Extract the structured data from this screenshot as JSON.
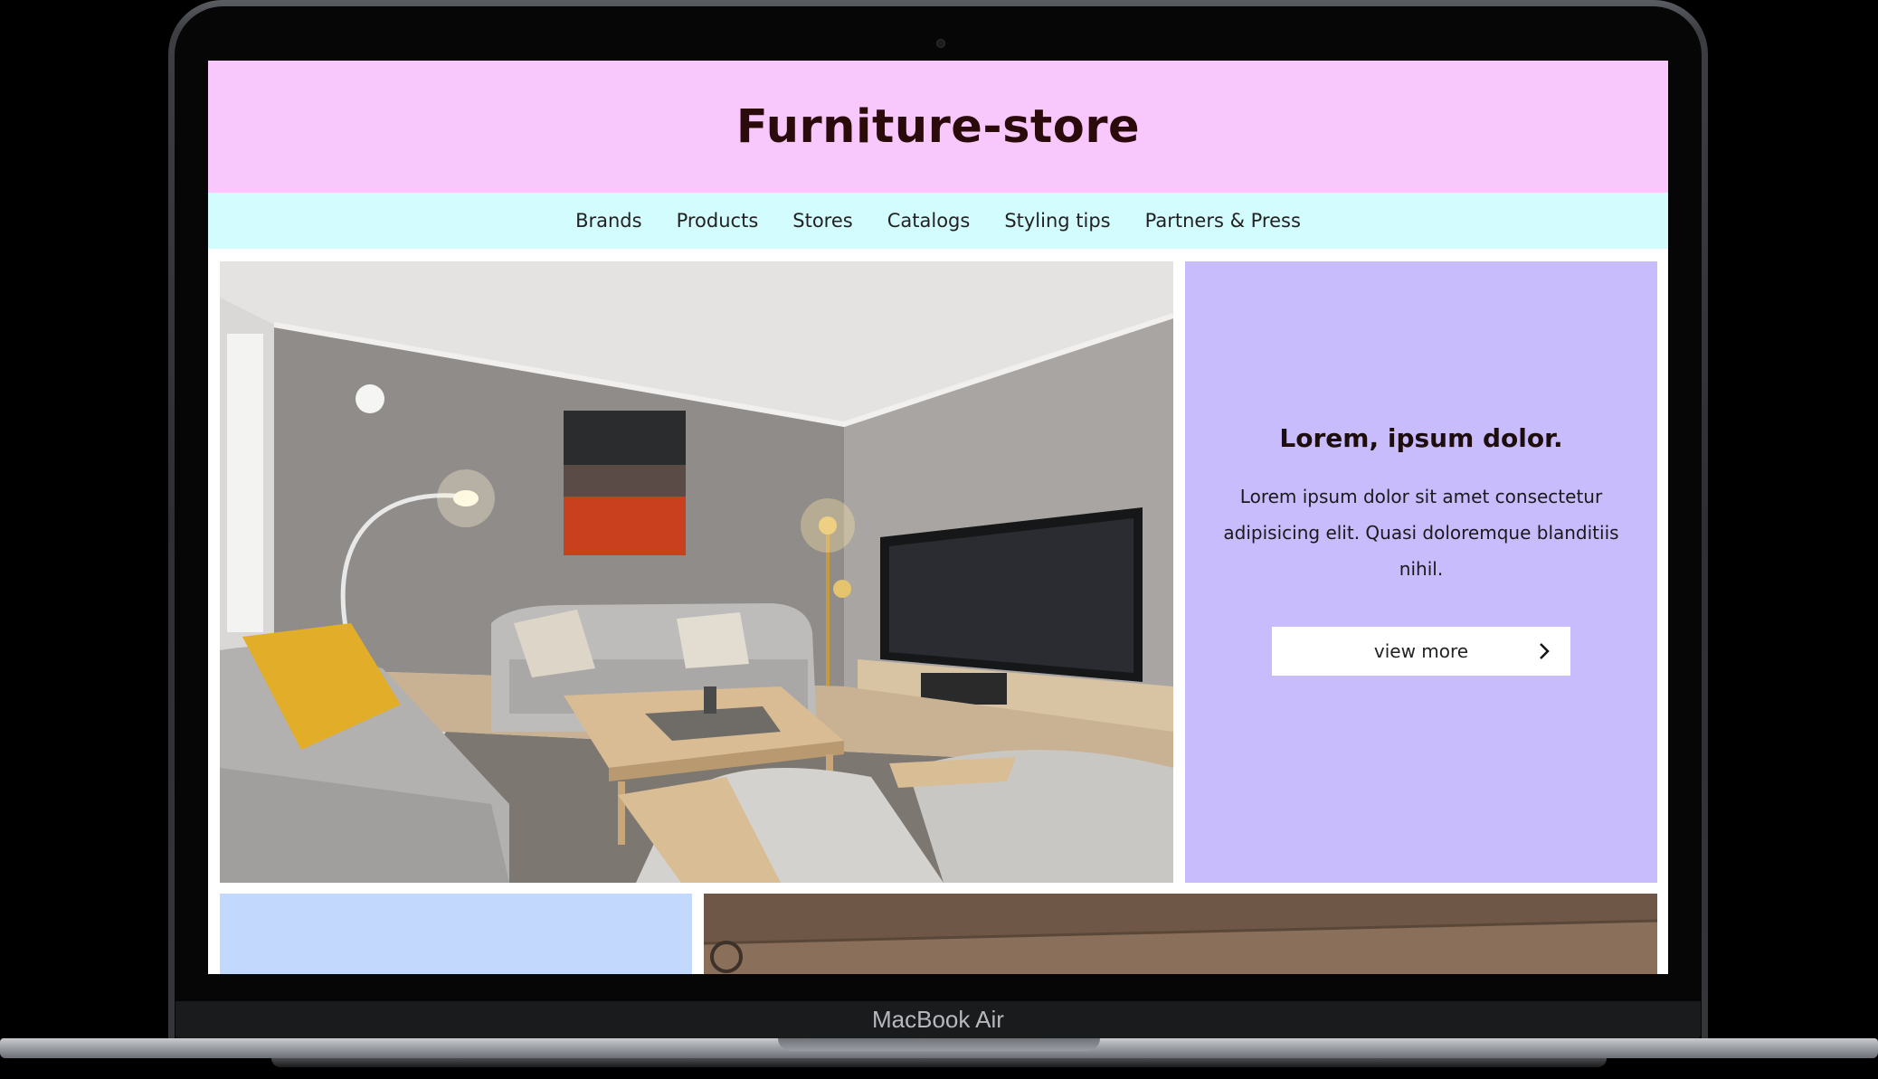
{
  "device": {
    "label": "MacBook Air"
  },
  "site": {
    "title": "Furniture-store",
    "colors": {
      "header_bg": "#f8c8fc",
      "nav_bg": "#d2fcfd",
      "card_bg": "#c8bcfc",
      "tile_bg": "#c3d8fd"
    }
  },
  "nav": {
    "items": [
      {
        "label": "Brands"
      },
      {
        "label": "Products"
      },
      {
        "label": "Stores"
      },
      {
        "label": "Catalogs"
      },
      {
        "label": "Styling tips"
      },
      {
        "label": "Partners & Press"
      }
    ]
  },
  "hero": {
    "card_title": "Lorem, ipsum dolor.",
    "card_text": "Lorem ipsum dolor sit amet consectetur adipisicing elit. Quasi doloremque blanditiis nihil.",
    "button_label": "view more",
    "button_icon": "chevron-right-icon"
  }
}
